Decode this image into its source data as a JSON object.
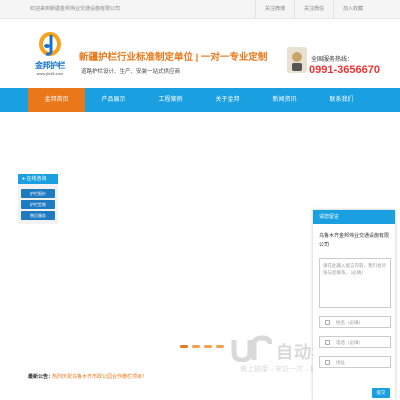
{
  "topbar": {
    "welcome": "欢迎来到新疆金邦伟业交通设施有限公司",
    "links": [
      "关注微博",
      "关注微信",
      "加入收藏"
    ]
  },
  "header": {
    "logo_name": "金邦护栏",
    "logo_url": "www.jbhl6.com",
    "slogan": "新疆护栏行业标准制定单位 | 一对一专业定制",
    "subslogan": "道路护栏设计、生产、安装一站式供应商",
    "hotline_label": "全国服务热线：",
    "hotline_number": "0991-3656670"
  },
  "nav": {
    "items": [
      "金邦首页",
      "产品展示",
      "工程案例",
      "关于金邦",
      "新闻资讯",
      "联系我们"
    ],
    "active_index": 0
  },
  "service": {
    "title": "在线咨询",
    "buttons": [
      "护栏报价",
      "护栏定制",
      "售后服务"
    ]
  },
  "message": {
    "title": "请您留言",
    "company": "乌鲁木齐金邦伟业交通设施有限公司",
    "textarea_placeholder": "请在此输入留言内容，我们会尽快与您联系。（必填）",
    "name_placeholder": "姓名（必填）",
    "phone_placeholder": "电话（必填）",
    "address_placeholder": "地址",
    "submit": "提交"
  },
  "notice": {
    "label": "最新公告：",
    "text": "热烈庆祝乌鲁木齐市政公园合作栅栏项目！"
  },
  "watermark": {
    "big": "自动秒收录",
    "small": "做上链接→来访一次→自动收录"
  },
  "colors": {
    "accent_blue": "#1aa0e0",
    "accent_orange": "#e8781a",
    "hotline_red": "#e33333"
  }
}
